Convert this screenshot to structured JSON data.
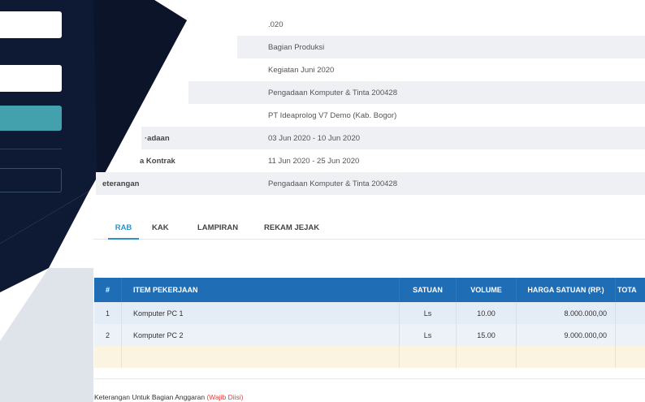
{
  "details": [
    {
      "label": "",
      "value": ".020"
    },
    {
      "label": "",
      "value": "Bagian Produksi"
    },
    {
      "label": "",
      "value": "Kegiatan Juni 2020"
    },
    {
      "label": "",
      "value": "Pengadaan Komputer & Tinta 200428"
    },
    {
      "label": "",
      "value": "PT Ideaprolog V7 Demo (Kab. Bogor)"
    },
    {
      "label": "·adaan",
      "value": "03 Jun 2020 - 10 Jun 2020"
    },
    {
      "label": "a Kontrak",
      "value": "11 Jun 2020 - 25 Jun 2020"
    },
    {
      "label": "eterangan",
      "value": "Pengadaan Komputer & Tinta 200428"
    }
  ],
  "tabs": [
    "RAB",
    "KAK",
    "LAMPIRAN",
    "REKAM JEJAK"
  ],
  "active_tab": "RAB",
  "table": {
    "headers": [
      "#",
      "ITEM PEKERJAAN",
      "SATUAN",
      "VOLUME",
      "HARGA SATUAN (RP.)",
      "TOTA"
    ],
    "rows": [
      {
        "no": "1",
        "item": "Komputer PC 1",
        "satuan": "Ls",
        "volume": "10.00",
        "harga": "8.000.000,00",
        "total": ""
      },
      {
        "no": "2",
        "item": "Komputer PC 2",
        "satuan": "Ls",
        "volume": "15.00",
        "harga": "9.000.000,00",
        "total": ""
      }
    ]
  },
  "note": {
    "text": "Keterangan Untuk Bagian Anggaran ",
    "required": "(Wajib Diisi)"
  },
  "colors": {
    "navy": "#0e1a33",
    "accent": "#2b93c4",
    "header": "#1f6db4",
    "button": "#43a1ad"
  }
}
